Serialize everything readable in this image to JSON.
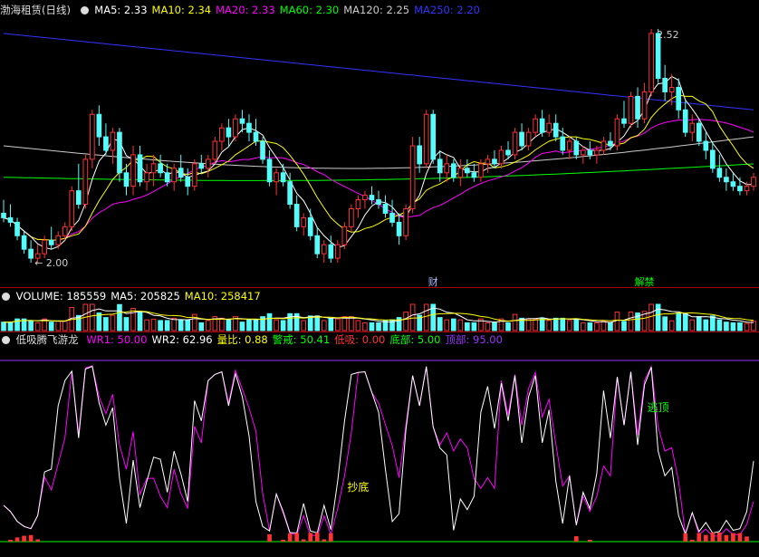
{
  "chart_data": [
    {
      "type": "candlestick",
      "panel": "price",
      "title": "渤海租赁(日线)",
      "indicators": [
        {
          "name": "MA5",
          "value": "2.33",
          "color": "#ffffff"
        },
        {
          "name": "MA10",
          "value": "2.34",
          "color": "#ffff00"
        },
        {
          "name": "MA20",
          "value": "2.33",
          "color": "#ff00ff"
        },
        {
          "name": "MA60",
          "value": "2.30",
          "color": "#00ff00"
        },
        {
          "name": "MA120",
          "value": "2.25",
          "color": "#cccccc"
        },
        {
          "name": "MA250",
          "value": "2.20",
          "color": "#3333ff"
        }
      ],
      "ylim": [
        1.98,
        2.54
      ],
      "high_marker": "2.52",
      "low_marker": "← 2.00",
      "event_labels": [
        "财",
        "解禁"
      ],
      "colors": {
        "up": "#ff3232",
        "down": "#54fcfc"
      },
      "candles": [
        [
          2.11,
          2.14,
          2.09,
          2.1
        ],
        [
          2.1,
          2.13,
          2.08,
          2.09
        ],
        [
          2.09,
          2.1,
          2.05,
          2.06
        ],
        [
          2.06,
          2.07,
          2.02,
          2.03
        ],
        [
          2.03,
          2.05,
          2.0,
          2.01
        ],
        [
          2.01,
          2.04,
          2.0,
          2.02
        ],
        [
          2.02,
          2.06,
          2.01,
          2.05
        ],
        [
          2.05,
          2.08,
          2.03,
          2.04
        ],
        [
          2.04,
          2.07,
          2.03,
          2.06
        ],
        [
          2.06,
          2.09,
          2.05,
          2.08
        ],
        [
          2.08,
          2.17,
          2.07,
          2.16
        ],
        [
          2.16,
          2.22,
          2.12,
          2.13
        ],
        [
          2.13,
          2.24,
          2.12,
          2.23
        ],
        [
          2.23,
          2.34,
          2.21,
          2.33
        ],
        [
          2.33,
          2.35,
          2.26,
          2.28
        ],
        [
          2.28,
          2.31,
          2.24,
          2.25
        ],
        [
          2.25,
          2.3,
          2.22,
          2.29
        ],
        [
          2.29,
          2.3,
          2.18,
          2.2
        ],
        [
          2.2,
          2.22,
          2.15,
          2.17
        ],
        [
          2.17,
          2.26,
          2.15,
          2.24
        ],
        [
          2.24,
          2.26,
          2.17,
          2.18
        ],
        [
          2.18,
          2.22,
          2.16,
          2.2
        ],
        [
          2.2,
          2.24,
          2.17,
          2.22
        ],
        [
          2.22,
          2.24,
          2.19,
          2.2
        ],
        [
          2.2,
          2.22,
          2.17,
          2.18
        ],
        [
          2.18,
          2.22,
          2.16,
          2.21
        ],
        [
          2.21,
          2.24,
          2.18,
          2.19
        ],
        [
          2.19,
          2.21,
          2.15,
          2.17
        ],
        [
          2.17,
          2.23,
          2.16,
          2.22
        ],
        [
          2.22,
          2.24,
          2.2,
          2.21
        ],
        [
          2.21,
          2.24,
          2.19,
          2.23
        ],
        [
          2.23,
          2.28,
          2.22,
          2.27
        ],
        [
          2.27,
          2.31,
          2.25,
          2.3
        ],
        [
          2.3,
          2.32,
          2.26,
          2.28
        ],
        [
          2.28,
          2.33,
          2.27,
          2.32
        ],
        [
          2.32,
          2.34,
          2.29,
          2.31
        ],
        [
          2.31,
          2.33,
          2.27,
          2.29
        ],
        [
          2.29,
          2.32,
          2.26,
          2.27
        ],
        [
          2.27,
          2.28,
          2.22,
          2.23
        ],
        [
          2.23,
          2.25,
          2.17,
          2.18
        ],
        [
          2.18,
          2.21,
          2.15,
          2.2
        ],
        [
          2.2,
          2.22,
          2.17,
          2.18
        ],
        [
          2.18,
          2.2,
          2.12,
          2.13
        ],
        [
          2.13,
          2.15,
          2.07,
          2.08
        ],
        [
          2.08,
          2.11,
          2.06,
          2.1
        ],
        [
          2.1,
          2.12,
          2.05,
          2.06
        ],
        [
          2.06,
          2.08,
          2.01,
          2.02
        ],
        [
          2.02,
          2.05,
          2.0,
          2.04
        ],
        [
          2.04,
          2.06,
          2.0,
          2.01
        ],
        [
          2.01,
          2.05,
          2.0,
          2.04
        ],
        [
          2.04,
          2.09,
          2.03,
          2.08
        ],
        [
          2.08,
          2.13,
          2.07,
          2.12
        ],
        [
          2.12,
          2.15,
          2.1,
          2.14
        ],
        [
          2.14,
          2.16,
          2.12,
          2.15
        ],
        [
          2.15,
          2.17,
          2.13,
          2.14
        ],
        [
          2.14,
          2.16,
          2.12,
          2.13
        ],
        [
          2.13,
          2.15,
          2.1,
          2.11
        ],
        [
          2.11,
          2.14,
          2.08,
          2.09
        ],
        [
          2.09,
          2.11,
          2.04,
          2.06
        ],
        [
          2.06,
          2.13,
          2.05,
          2.12
        ],
        [
          2.12,
          2.28,
          2.11,
          2.26
        ],
        [
          2.26,
          2.28,
          2.2,
          2.22
        ],
        [
          2.22,
          2.34,
          2.21,
          2.33
        ],
        [
          2.33,
          2.34,
          2.22,
          2.23
        ],
        [
          2.23,
          2.25,
          2.18,
          2.2
        ],
        [
          2.2,
          2.24,
          2.18,
          2.22
        ],
        [
          2.22,
          2.23,
          2.18,
          2.19
        ],
        [
          2.19,
          2.23,
          2.17,
          2.21
        ],
        [
          2.21,
          2.23,
          2.19,
          2.2
        ],
        [
          2.2,
          2.22,
          2.18,
          2.19
        ],
        [
          2.19,
          2.23,
          2.18,
          2.22
        ],
        [
          2.22,
          2.24,
          2.2,
          2.23
        ],
        [
          2.23,
          2.25,
          2.21,
          2.22
        ],
        [
          2.22,
          2.26,
          2.21,
          2.25
        ],
        [
          2.25,
          2.27,
          2.23,
          2.24
        ],
        [
          2.24,
          2.3,
          2.23,
          2.29
        ],
        [
          2.29,
          2.31,
          2.25,
          2.26
        ],
        [
          2.26,
          2.3,
          2.25,
          2.29
        ],
        [
          2.29,
          2.33,
          2.28,
          2.32
        ],
        [
          2.32,
          2.34,
          2.28,
          2.29
        ],
        [
          2.29,
          2.33,
          2.28,
          2.31
        ],
        [
          2.31,
          2.33,
          2.27,
          2.28
        ],
        [
          2.28,
          2.3,
          2.24,
          2.25
        ],
        [
          2.25,
          2.28,
          2.23,
          2.27
        ],
        [
          2.27,
          2.28,
          2.23,
          2.24
        ],
        [
          2.24,
          2.26,
          2.22,
          2.25
        ],
        [
          2.25,
          2.27,
          2.23,
          2.24
        ],
        [
          2.24,
          2.26,
          2.22,
          2.25
        ],
        [
          2.25,
          2.28,
          2.24,
          2.27
        ],
        [
          2.27,
          2.29,
          2.25,
          2.26
        ],
        [
          2.26,
          2.33,
          2.25,
          2.32
        ],
        [
          2.32,
          2.36,
          2.3,
          2.31
        ],
        [
          2.31,
          2.38,
          2.3,
          2.37
        ],
        [
          2.37,
          2.39,
          2.3,
          2.32
        ],
        [
          2.32,
          2.4,
          2.31,
          2.38
        ],
        [
          2.38,
          2.52,
          2.37,
          2.51
        ],
        [
          2.51,
          2.52,
          2.4,
          2.41
        ],
        [
          2.41,
          2.44,
          2.36,
          2.38
        ],
        [
          2.38,
          2.42,
          2.35,
          2.39
        ],
        [
          2.39,
          2.41,
          2.32,
          2.34
        ],
        [
          2.34,
          2.36,
          2.28,
          2.29
        ],
        [
          2.29,
          2.33,
          2.27,
          2.31
        ],
        [
          2.31,
          2.32,
          2.26,
          2.27
        ],
        [
          2.27,
          2.29,
          2.23,
          2.25
        ],
        [
          2.25,
          2.27,
          2.2,
          2.21
        ],
        [
          2.21,
          2.24,
          2.18,
          2.19
        ],
        [
          2.19,
          2.21,
          2.16,
          2.18
        ],
        [
          2.18,
          2.2,
          2.16,
          2.17
        ],
        [
          2.17,
          2.19,
          2.15,
          2.16
        ],
        [
          2.16,
          2.18,
          2.15,
          2.17
        ],
        [
          2.17,
          2.2,
          2.16,
          2.19
        ]
      ]
    },
    {
      "type": "bar",
      "panel": "volume",
      "title": "VOLUME",
      "indicators": [
        {
          "name": "VOLUME",
          "value": "185559",
          "color": "#ffffff"
        },
        {
          "name": "MA5",
          "value": "205825",
          "color": "#ffffff"
        },
        {
          "name": "MA10",
          "value": "258417",
          "color": "#ffff00"
        }
      ]
    },
    {
      "type": "line",
      "panel": "oscillator",
      "title": "低吸腾飞游龙",
      "indicators": [
        {
          "name": "WR1",
          "value": "50.00",
          "color": "#ff00ff"
        },
        {
          "name": "WR2",
          "value": "62.96",
          "color": "#ffffff"
        },
        {
          "name": "量比",
          "value": "0.88",
          "color": "#ffff00"
        },
        {
          "name": "警戒",
          "value": "50.41",
          "color": "#00ff00"
        },
        {
          "name": "低吸",
          "value": "0.00",
          "color": "#ff3232"
        },
        {
          "name": "底部",
          "value": "5.00",
          "color": "#00ff00"
        },
        {
          "name": "顶部",
          "value": "95.00",
          "color": "#9933ff"
        }
      ],
      "ylim": [
        0,
        100
      ],
      "annotations": [
        {
          "text": "抄底",
          "color": "#ffff00"
        },
        {
          "text": "逃顶",
          "color": "#00ff00"
        }
      ]
    }
  ]
}
